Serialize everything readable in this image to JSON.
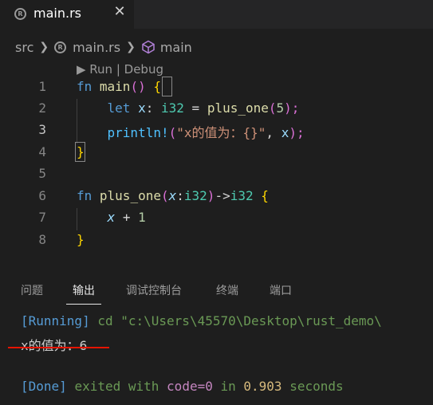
{
  "tab": {
    "label": "main.rs",
    "close": "✕",
    "icon": "rust-file-icon"
  },
  "breadcrumb": {
    "folder": "src",
    "file": "main.rs",
    "symbol": "main"
  },
  "codelens": "▶ Run | Debug",
  "code": {
    "line_numbers": [
      "1",
      "2",
      "3",
      "4",
      "5",
      "6",
      "7",
      "8"
    ],
    "active_line": "3",
    "lines": {
      "l1": {
        "kw": "fn",
        "name": "main",
        "parens": "()",
        "brace": "{"
      },
      "l2": {
        "kw": "let",
        "var": "x",
        "colon": ":",
        "type": "i32",
        "eq": "=",
        "call": "plus_one",
        "open": "(",
        "num": "5",
        "close": ");"
      },
      "l3": {
        "macro": "println!",
        "open": "(",
        "str": "\"x的值为：{}\"",
        "comma": ",",
        "var": "x",
        "close": ");"
      },
      "l4": {
        "brace": "}"
      },
      "l6": {
        "kw": "fn",
        "name": "plus_one",
        "open": "(",
        "param": "x",
        "colon": ":",
        "ptype": "i32",
        "close": ")",
        "arrow": "->",
        "rtype": "i32",
        "brace": "{"
      },
      "l7": {
        "param": "x",
        "op": "+",
        "num": "1"
      },
      "l8": {
        "brace": "}"
      }
    }
  },
  "panel": {
    "tabs": [
      "问题",
      "输出",
      "调试控制台",
      "终端",
      "端口"
    ],
    "active_tab": "输出"
  },
  "output": {
    "running_tag": "[Running]",
    "running_cmd": "cd \"c:\\Users\\45570\\Desktop\\rust_demo\\",
    "result": "x的值为：6",
    "done_tag": "[Done]",
    "done_text": "exited with",
    "done_code": "code=0",
    "done_in": "in",
    "done_time": "0.903",
    "done_seconds": "seconds"
  },
  "colors": {
    "accent_underline": "#e51400",
    "background": "#1e1e1e"
  }
}
